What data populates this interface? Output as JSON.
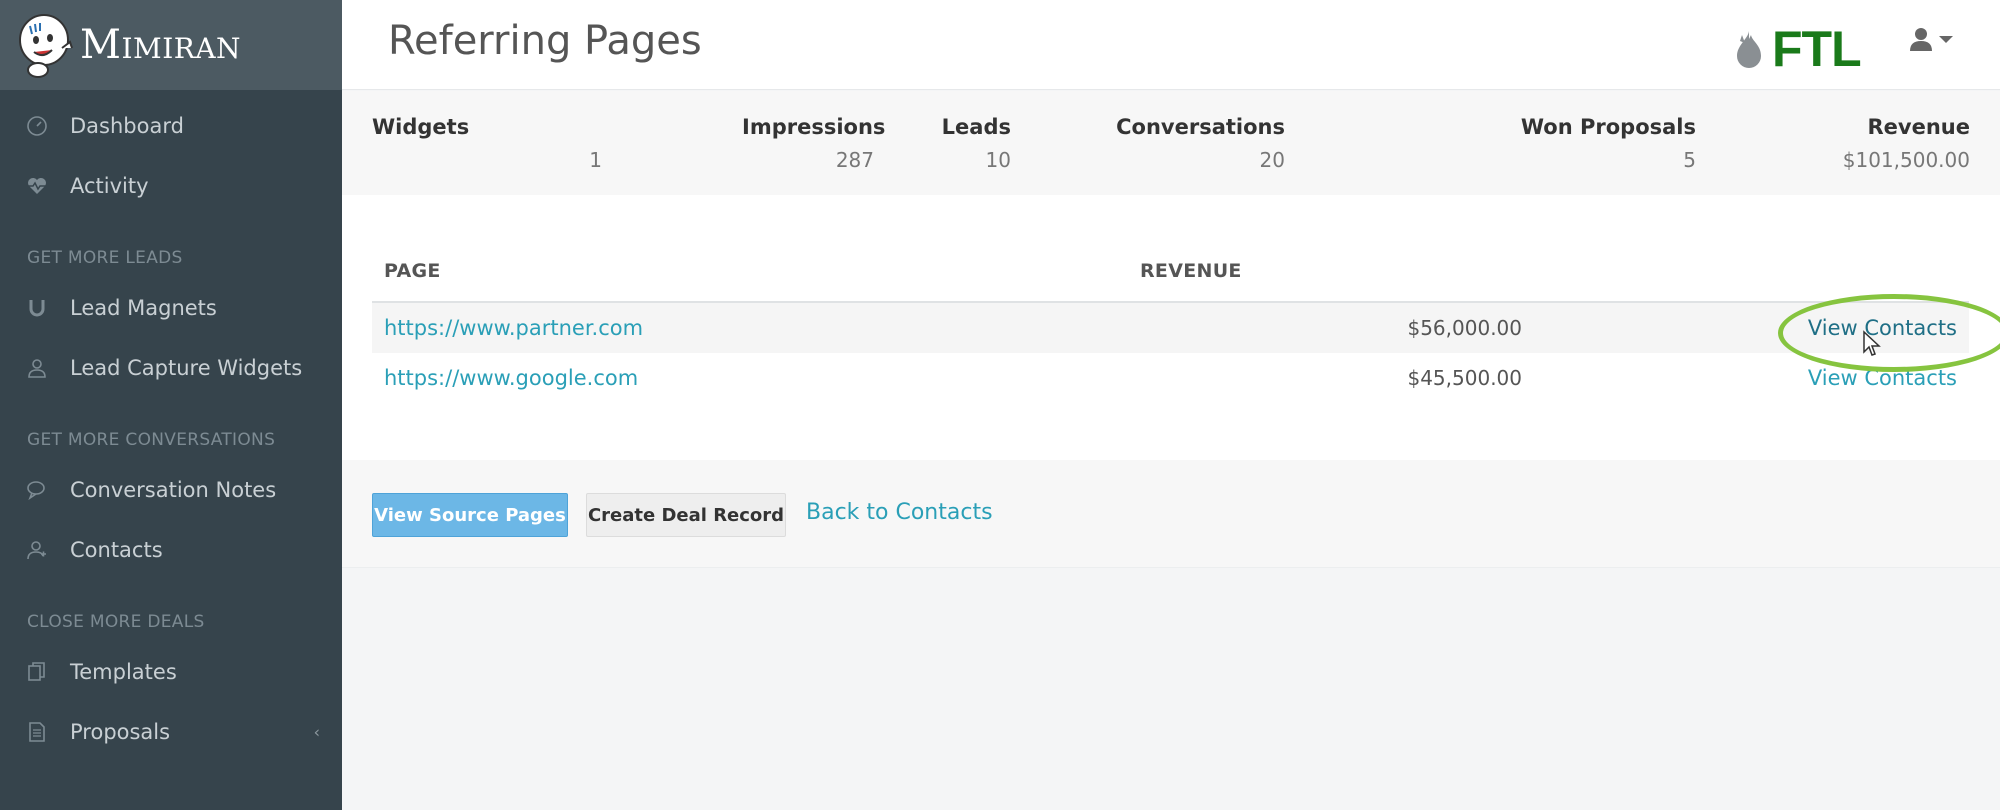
{
  "brand": {
    "name": "Mimiran"
  },
  "sidebar": {
    "items": [
      {
        "label": "Dashboard",
        "icon": "dashboard-icon"
      },
      {
        "label": "Activity",
        "icon": "heartbeat-icon"
      }
    ],
    "sections": [
      {
        "title": "GET MORE LEADS",
        "items": [
          {
            "label": "Lead Magnets",
            "icon": "magnet-icon"
          },
          {
            "label": "Lead Capture Widgets",
            "icon": "user-icon"
          }
        ]
      },
      {
        "title": "GET MORE CONVERSATIONS",
        "items": [
          {
            "label": "Conversation Notes",
            "icon": "comments-icon"
          },
          {
            "label": "Contacts",
            "icon": "contacts-icon"
          }
        ]
      },
      {
        "title": "CLOSE MORE DEALS",
        "items": [
          {
            "label": "Templates",
            "icon": "copy-icon"
          },
          {
            "label": "Proposals",
            "icon": "document-icon",
            "has_chevron": true,
            "chevron": "‹"
          }
        ]
      }
    ]
  },
  "header": {
    "title": "Referring Pages",
    "logo_text": "FTL",
    "logo_color": "#1a7a1a"
  },
  "stats": [
    {
      "label": "Widgets",
      "value": "1"
    },
    {
      "label": "Impressions",
      "value": "287"
    },
    {
      "label": "Leads",
      "value": "10"
    },
    {
      "label": "Conversations",
      "value": "20"
    },
    {
      "label": "Won Proposals",
      "value": "5"
    },
    {
      "label": "Revenue",
      "value": "$101,500.00"
    }
  ],
  "table": {
    "headers": {
      "page": "PAGE",
      "revenue": "REVENUE"
    },
    "rows": [
      {
        "page": "https://www.partner.com",
        "revenue": "$56,000.00",
        "action": "View Contacts"
      },
      {
        "page": "https://www.google.com",
        "revenue": "$45,500.00",
        "action": "View Contacts"
      }
    ]
  },
  "actions": {
    "primary": "View Source Pages",
    "secondary": "Create Deal Record",
    "back_link": "Back to Contacts"
  },
  "colors": {
    "sidebar_bg": "#36444c",
    "link": "#2a9fb7",
    "primary_button": "#6cb7e6",
    "highlight": "#86c43f"
  }
}
